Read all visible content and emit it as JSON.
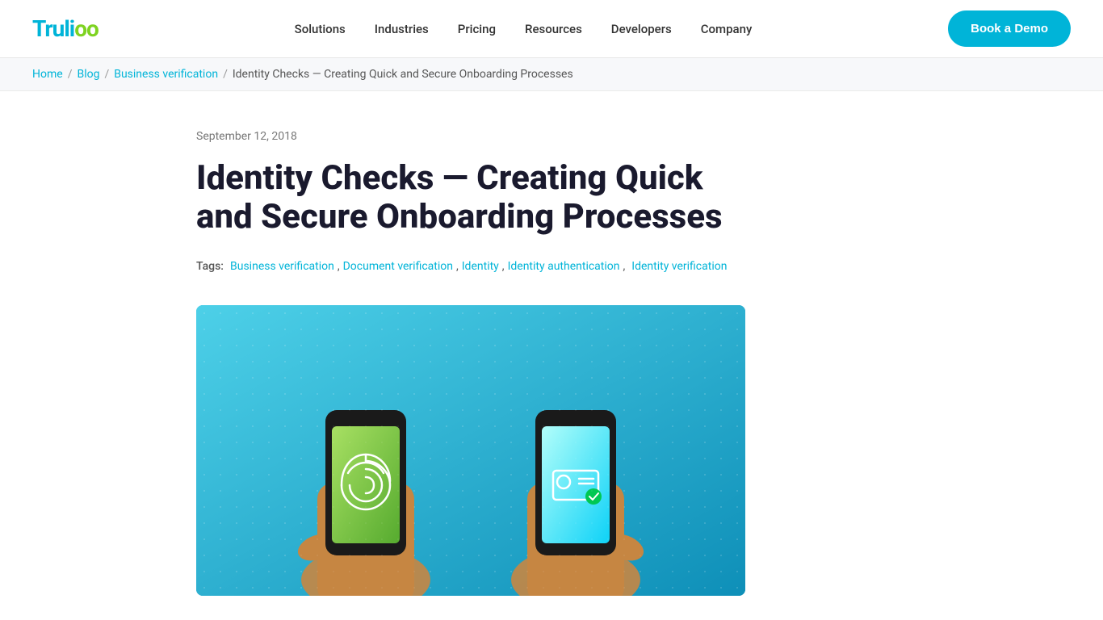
{
  "header": {
    "logo_truli": "Truli",
    "logo_oo": "oo",
    "nav_items": [
      {
        "label": "Solutions",
        "id": "solutions"
      },
      {
        "label": "Industries",
        "id": "industries"
      },
      {
        "label": "Pricing",
        "id": "pricing"
      },
      {
        "label": "Resources",
        "id": "resources"
      },
      {
        "label": "Developers",
        "id": "developers"
      },
      {
        "label": "Company",
        "id": "company"
      }
    ],
    "cta_label": "Book a Demo"
  },
  "breadcrumb": {
    "home": "Home",
    "blog": "Blog",
    "category": "Business verification",
    "current": "Identity Checks — Creating Quick and Secure Onboarding Processes"
  },
  "article": {
    "date": "September 12, 2018",
    "title": "Identity Checks — Creating Quick and Secure Onboarding Processes",
    "tags_label": "Tags:",
    "tags": [
      {
        "label": "Business verification",
        "id": "business-verification"
      },
      {
        "label": "Document verification",
        "id": "document-verification"
      },
      {
        "label": "Identity",
        "id": "identity"
      },
      {
        "label": "Identity authentication",
        "id": "identity-authentication"
      },
      {
        "label": "Identity verification",
        "id": "identity-verification"
      }
    ]
  },
  "colors": {
    "primary": "#00b4d8",
    "green": "#7ed321",
    "text_dark": "#1a1a2e",
    "text_medium": "#555555",
    "text_light": "#777777",
    "link": "#00b4d8",
    "hero_bg": "#29bce8"
  }
}
